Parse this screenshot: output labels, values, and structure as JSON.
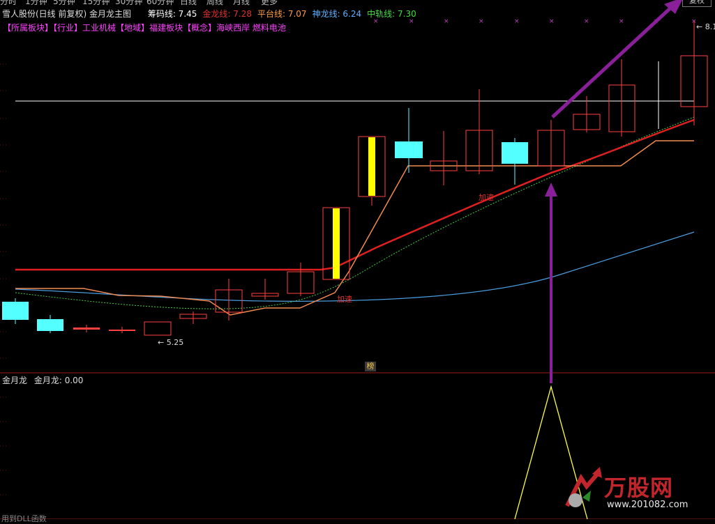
{
  "topbar": {
    "items": [
      "分时",
      "1分钟",
      "5分钟",
      "15分钟",
      "30分钟",
      "60分钟",
      "日线",
      "周线",
      "月线",
      "更多"
    ],
    "rebuild_label": "复权"
  },
  "header": {
    "title": "雪人股份(日线 前复权) 金月龙主图",
    "indicators": [
      {
        "label": "筹码线: 7.45",
        "color": "#ffffff"
      },
      {
        "label": "金龙线: 7.28",
        "color": "#e03030"
      },
      {
        "label": "平台线: 7.07",
        "color": "#ff9a40"
      },
      {
        "label": "神龙线: 6.24",
        "color": "#5cb0ff"
      },
      {
        "label": "中轨线: 7.30",
        "color": "#40e040"
      }
    ]
  },
  "sector_tags": {
    "text_parts": [
      {
        "text": "【所属板块】",
        "color": "#ff40ff"
      },
      {
        "text": "【行业】",
        "color": "#ff40ff"
      },
      {
        "text": "工业机械",
        "color": "#ff40ff"
      },
      {
        "text": "【地域】",
        "color": "#ff40ff"
      },
      {
        "text": "福建板块",
        "color": "#ff40ff"
      },
      {
        "text": "【概念】",
        "color": "#ff40ff"
      },
      {
        "text": "海峡西岸 燃料电池",
        "color": "#ff40ff"
      }
    ]
  },
  "main_chart": {
    "annotations": {
      "low_label": "5.25",
      "high_label": "8.1",
      "accel_1": "加速",
      "accel_2": "加速",
      "bang_label": "榜"
    },
    "colors": {
      "up_candle": "#ff4040",
      "down_candle": "#54ffff",
      "yellow_bar": "#ffff00",
      "gold_line": "#e02020",
      "platform_line": "#f08a50",
      "shenlong_line": "#4a9ee0",
      "midband_line": "#40d040",
      "white_line": "#ffffff",
      "arrow": "#9020a0"
    }
  },
  "sub_chart": {
    "title": "金月龙",
    "value_label": "金月龙: 0.00",
    "line_color": "#ffff40"
  },
  "bottom_hint": "用到DLL函数",
  "logo": {
    "title": "万股网",
    "url": "www.201082.com"
  }
}
